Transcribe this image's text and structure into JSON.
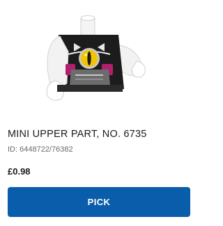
{
  "product": {
    "image_icon": "minifigure-torso-icon",
    "name": "MINI UPPER PART, NO. 6735",
    "id_text": "ID: 6448722/76382",
    "price": "£0.98"
  },
  "actions": {
    "pick_label": "PICK"
  },
  "colors": {
    "button_background": "#0a5dab",
    "button_text": "#ffffff",
    "title_text": "#1b1b1b",
    "secondary_text": "#6b6b6b"
  }
}
